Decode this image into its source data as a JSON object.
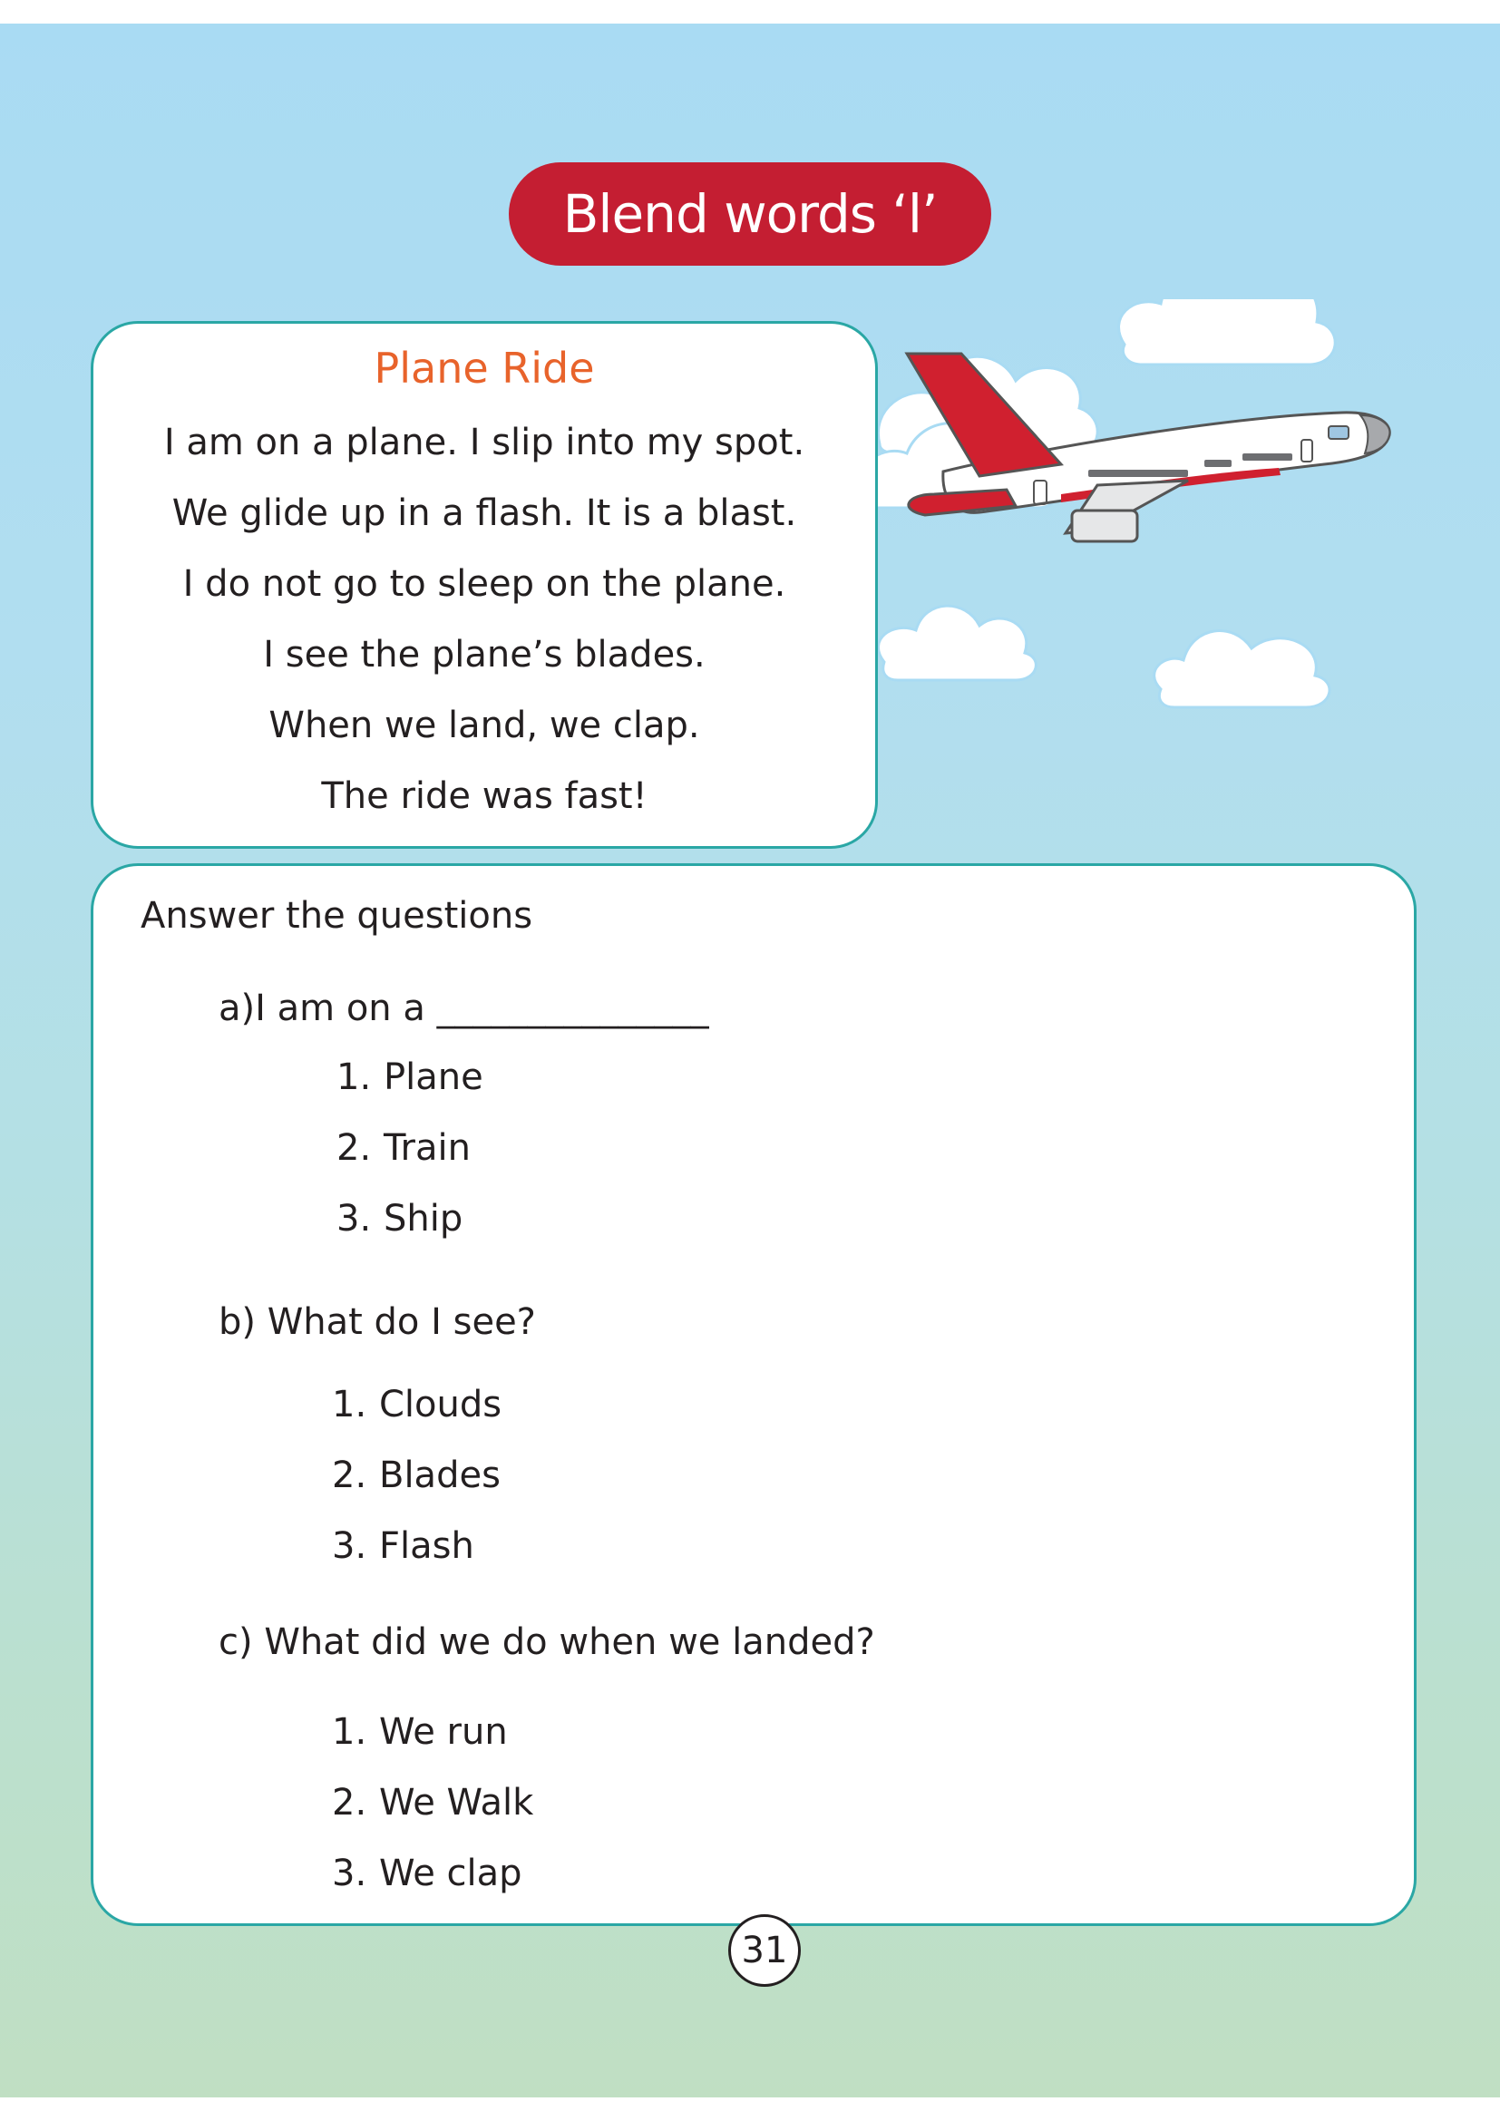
{
  "title": "Blend words ‘l’",
  "story": {
    "title": "Plane Ride",
    "lines": [
      "I am on a plane. I slip into my spot.",
      "We glide up in a flash. It is a blast.",
      "I do not go to sleep on the plane.",
      "I see the plane’s blades.",
      "When we land, we clap.",
      "The ride was fast!"
    ]
  },
  "questions": {
    "heading": "Answer the questions",
    "items": [
      {
        "label": "a)I am on a _______________",
        "options": [
          {
            "num": "1.",
            "text": "Plane"
          },
          {
            "num": "2.",
            "text": "Train"
          },
          {
            "num": "3.",
            "text": "Ship"
          }
        ]
      },
      {
        "label": "b) What do I see?",
        "options": [
          {
            "num": "1.",
            "text": "Clouds"
          },
          {
            "num": "2.",
            "text": "Blades"
          },
          {
            "num": "3.",
            "text": "Flash"
          }
        ]
      },
      {
        "label": "c) What did we do when we landed?",
        "options": [
          {
            "num": "1.",
            "text": "We run"
          },
          {
            "num": "2.",
            "text": "We Walk"
          },
          {
            "num": "3.",
            "text": "We clap"
          }
        ]
      }
    ]
  },
  "page_number": "31",
  "colors": {
    "title_pill": "#c41e32",
    "story_title": "#e8632b",
    "box_border": "#2aa7a5",
    "plane_red": "#d0202f"
  },
  "illustration": {
    "icon": "airplane-with-clouds-icon"
  }
}
